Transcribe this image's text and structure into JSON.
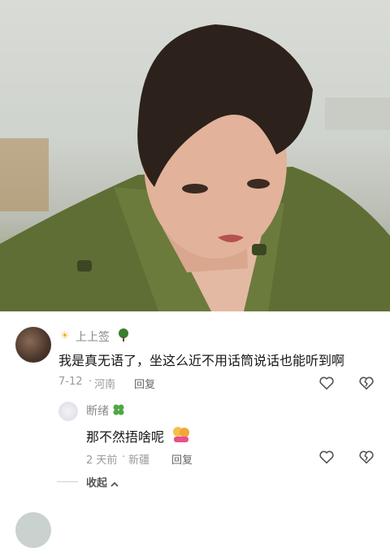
{
  "comments": [
    {
      "username": "上上签",
      "text": "我是真无语了，坐这么近不用话筒说话也能听到啊",
      "date": "7-12",
      "location": "河南",
      "reply_label": "回复"
    }
  ],
  "replies": [
    {
      "username": "断绪",
      "text": "那不然捂啥呢",
      "date": "2 天前",
      "location": "新疆",
      "reply_label": "回复"
    }
  ],
  "collapse_label": "收起",
  "icons": {
    "sun_badge": "sun-icon",
    "tree_badge": "tree-icon",
    "clover_badge": "clover-icon",
    "emoji": "hugging-couple-emoji",
    "like": "heart-outline-icon",
    "dislike": "broken-heart-icon",
    "collapse": "chevron-up-icon"
  },
  "colors": {
    "text": "#161616",
    "meta": "#9a9a9a",
    "badge_green": "#3a7d2c"
  }
}
